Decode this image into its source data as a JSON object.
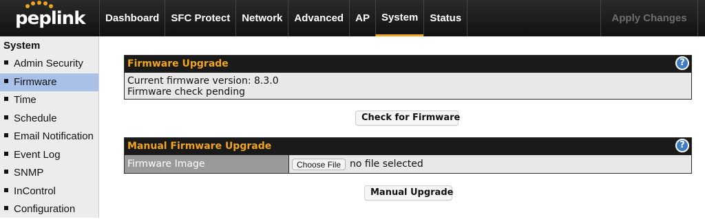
{
  "brand": {
    "logo_text": "peplink",
    "accent_color": "#f0a51c",
    "dots_color": "#f0a51c"
  },
  "nav": {
    "tabs": [
      {
        "label": "Dashboard"
      },
      {
        "label": "SFC Protect"
      },
      {
        "label": "Network"
      },
      {
        "label": "Advanced"
      },
      {
        "label": "AP"
      },
      {
        "label": "System",
        "active": true
      },
      {
        "label": "Status"
      }
    ],
    "apply_label": "Apply Changes"
  },
  "sidebar": {
    "title": "System",
    "items": [
      {
        "label": "Admin Security"
      },
      {
        "label": "Firmware",
        "active": true
      },
      {
        "label": "Time"
      },
      {
        "label": "Schedule"
      },
      {
        "label": "Email Notification"
      },
      {
        "label": "Event Log"
      },
      {
        "label": "SNMP"
      },
      {
        "label": "InControl"
      },
      {
        "label": "Configuration"
      }
    ]
  },
  "firmware_panel": {
    "title": "Firmware Upgrade",
    "help_icon": "help-icon",
    "current_version_text": "Current firmware version: 8.3.0",
    "check_status_text": "Firmware check pending"
  },
  "check_button_label": "Check for Firmware",
  "manual_panel": {
    "title": "Manual Firmware Upgrade",
    "help_icon": "help-icon",
    "image_label": "Firmware Image",
    "choose_file_label": "Choose File",
    "file_status": "no file selected"
  },
  "manual_button_label": "Manual Upgrade",
  "help_glyph": "?",
  "colors": {
    "topbar": "#1a1a1a",
    "sidebar_active": "#a9c1e6",
    "help": "#3e7cc4"
  }
}
